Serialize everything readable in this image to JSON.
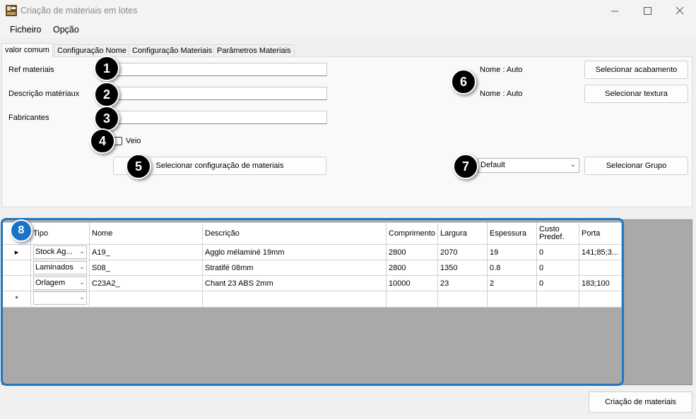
{
  "window": {
    "title": "Criação de materiais em lotes"
  },
  "menu": {
    "items": [
      "Ficheiro",
      "Opção"
    ]
  },
  "tabs": [
    "valor comum",
    "Configuração Nome",
    "Configuração Materiais",
    "Parâmetros Materiais"
  ],
  "form": {
    "ref_label": "Ref materiais",
    "ref_value": "",
    "desc_label": "Descrição matériaux",
    "desc_value": "",
    "fab_label": "Fabricantes",
    "fab_value": "",
    "veio_label": "Veio",
    "veio_checked": false,
    "config_button": "Selecionar configuração de materiais",
    "nome_acabamento": "Nome : Auto",
    "acabamento_button": "Selecionar acabamento",
    "nome_textura": "Nome : Auto",
    "textura_button": "Selecionar textura",
    "group_select": "Default",
    "group_button": "Selecionar Grupo"
  },
  "badges": [
    "1",
    "2",
    "3",
    "4",
    "5",
    "6",
    "7",
    "8"
  ],
  "grid": {
    "columns": [
      "Tipo",
      "Nome",
      "Descrição",
      "Comprimento",
      "Largura",
      "Espessura",
      "Custo Predef.",
      "Porta"
    ],
    "rows": [
      [
        "Stock Ag...",
        "A19_",
        "Agglo mélaminé 19mm",
        "2800",
        "2070",
        "19",
        "0",
        "141;85;3..."
      ],
      [
        "Laminados",
        "S08_",
        "Stratifé 08mm",
        "2800",
        "1350",
        "0.8",
        "0",
        ""
      ],
      [
        "Orlagem",
        "C23A2_",
        "Chant 23 ABS 2mm",
        "10000",
        "23",
        "2",
        "0",
        "183;100"
      ]
    ],
    "current_row_marker": "▸",
    "new_row_marker": "*"
  },
  "footer": {
    "create_button": "Criação de materiais"
  },
  "colors": {
    "accent": "#1f78c1",
    "grid_background": "#a9a9a9"
  }
}
